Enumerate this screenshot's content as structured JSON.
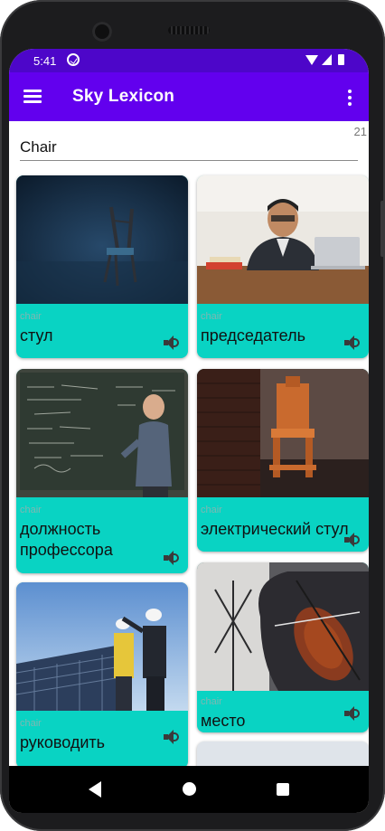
{
  "status_bar": {
    "time": "5:41"
  },
  "app_bar": {
    "title": "Sky Lexicon"
  },
  "search": {
    "value": "Chair",
    "result_count": "21"
  },
  "cards": [
    {
      "source": "chair",
      "word": "стул",
      "photo": "chair-photo"
    },
    {
      "source": "chair",
      "word": "председатель",
      "photo": "chairman-photo"
    },
    {
      "source": "chair",
      "word": "должность\nпрофессора",
      "photo": "professor-photo"
    },
    {
      "source": "chair",
      "word": "электрический стул",
      "photo": "electric-chair-photo"
    },
    {
      "source": "chair",
      "word": "руководить",
      "photo": "engineers-photo"
    },
    {
      "source": "chair",
      "word": "место",
      "photo": "cello-photo"
    }
  ],
  "colors": {
    "status_bar": "#4d06c9",
    "app_bar": "#6200ee",
    "card": "#09d3c3"
  }
}
